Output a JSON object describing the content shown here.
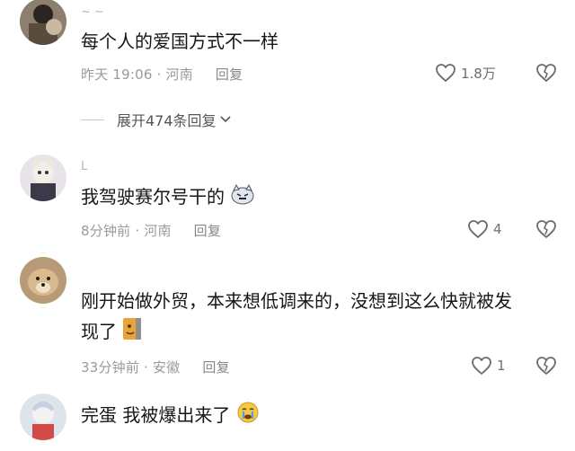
{
  "comments": [
    {
      "username": "~ ~",
      "text": "每个人的爱国方式不一样",
      "time": "昨天 19:06",
      "location": "河南",
      "reply": "回复",
      "likes": "1.8万",
      "expand": "展开474条回复"
    },
    {
      "username": "L",
      "text": "我驾驶赛尔号干的",
      "time": "8分钟前",
      "location": "河南",
      "reply": "回复",
      "likes": "4"
    },
    {
      "username": "",
      "text_line1": "刚开始做外贸，本来想低调来的，没想到这么快就被发",
      "text_line2": "现了",
      "time": "33分钟前",
      "location": "安徽",
      "reply": "回复",
      "likes": "1"
    },
    {
      "username": "",
      "text": "完蛋 我被爆出来了",
      "time": "",
      "location": "",
      "reply": "",
      "likes": ""
    }
  ],
  "colors": {
    "accent": "#161616",
    "meta": "#9a9a9a",
    "bg": "#ffffff"
  },
  "icons": [
    "heart-outline-icon",
    "broken-heart-icon",
    "chevron-down-icon",
    "cat-emoji-icon",
    "crying-emoji-icon",
    "square-sticker-icon"
  ]
}
